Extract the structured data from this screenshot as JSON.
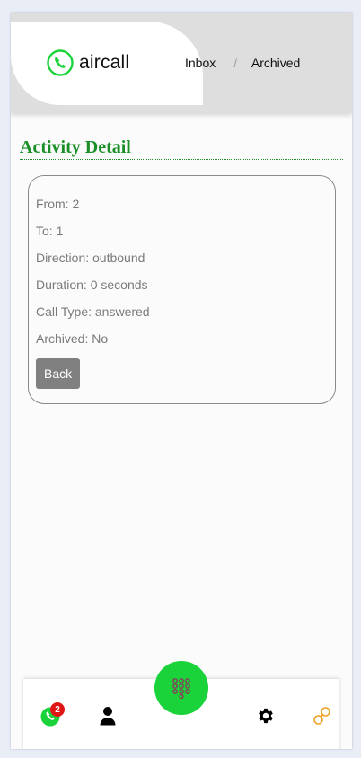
{
  "header": {
    "brand": "aircall",
    "nav": [
      {
        "label": "Inbox"
      },
      {
        "label": "Archived"
      }
    ],
    "separator": "/"
  },
  "page": {
    "title": "Activity Detail"
  },
  "detail": {
    "from": "From: 2",
    "to": "To: 1",
    "direction": "Direction: outbound",
    "duration": "Duration: 0 seconds",
    "call_type": "Call Type: answered",
    "archived": "Archived: No",
    "back_label": "Back"
  },
  "bottom_nav": {
    "calls_badge": "2",
    "items": [
      "phone-icon",
      "person-icon",
      "dialpad-icon",
      "gear-icon",
      "link-icon"
    ]
  },
  "colors": {
    "brand_green": "#1ad33a",
    "title_green": "#1b8f27",
    "badge_red": "#e01616",
    "link_orange": "#f0a020"
  }
}
